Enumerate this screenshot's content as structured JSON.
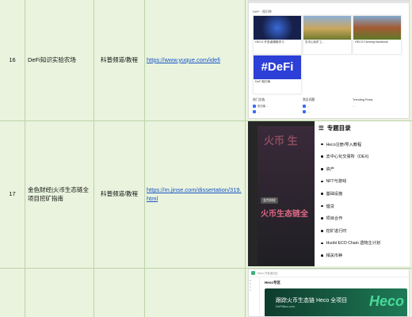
{
  "rows": [
    {
      "num": "16",
      "name": "DeFi知识实验农场",
      "category": "科普频道/教程",
      "link": "https://www.yuque.com/idefi",
      "screenshot": {
        "section_title": "DeFi · 知识库",
        "cards": [
          {
            "title": "HECO 开发者课程学习",
            "desc": "",
            "image": "network-sphere"
          },
          {
            "title": "去中心化矿工...",
            "desc": "",
            "image": "farm-tractor"
          },
          {
            "title": "HECO Farming Handbook",
            "desc": "",
            "image": "barn-field"
          },
          {
            "title": "DeFi 知识库",
            "desc": "",
            "image_text": "#DeFi"
          }
        ],
        "columns": [
          {
            "header": "热门文档",
            "items": [
              "知识库...",
              "..."
            ]
          },
          {
            "header": "常见问题",
            "items": [
              "...",
              "..."
            ]
          },
          {
            "header": "Trending Posts",
            "items": [
              "..."
            ]
          }
        ]
      }
    },
    {
      "num": "17",
      "name": "金色财经|火币生态链全项目挖矿指南",
      "category": "科普频道/教程",
      "link": "https://m.jinse.com/dissertation/319.html",
      "screenshot": {
        "poster_top": "火币 生",
        "poster_tag": "金色财经",
        "poster_text": "火币生态链全",
        "toc_title": "专题目录",
        "toc_items": [
          "Heco注册/导入教程",
          "去中心化交易所（DEX)",
          "资产",
          "NFT与游戏",
          "基础设施",
          "借贷",
          "项目合作",
          "挖矿进行时",
          "Huobi ECO Chain 遗物主计划",
          "相关币种"
        ]
      }
    },
    {
      "num": "",
      "name": "",
      "category": "",
      "link": "",
      "screenshot": {
        "topbar": "Heco 开发者社区",
        "page_title": "Heco专区",
        "banner_title": "跟踪火币生态链 Heco 全项目",
        "banner_sub": "DeFiBox.com",
        "banner_logo": "Heco"
      }
    }
  ]
}
